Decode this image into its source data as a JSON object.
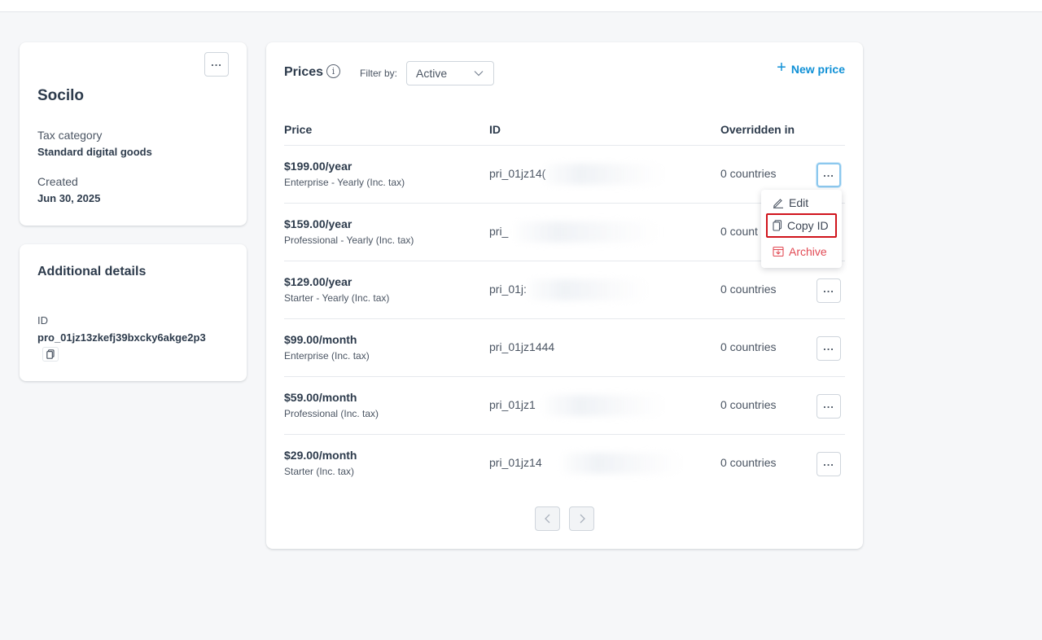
{
  "product": {
    "name": "Socilo",
    "tax_category_label": "Tax category",
    "tax_category_value": "Standard digital goods",
    "created_label": "Created",
    "created_value": "Jun 30, 2025",
    "more_label": "···"
  },
  "details": {
    "title": "Additional details",
    "id_label": "ID",
    "id_value": "pro_01jz13zkefj39bxcky6akge2p3"
  },
  "prices": {
    "title": "Prices",
    "filter_label": "Filter by:",
    "filter_value": "Active",
    "new_price_label": "New price",
    "columns": [
      "Price",
      "ID",
      "Overridden in"
    ],
    "rows": [
      {
        "price": "$199.00/year",
        "description": "Enterprise - Yearly (Inc. tax)",
        "id": "pri_01jz14(",
        "overridden": "0 countries"
      },
      {
        "price": "$159.00/year",
        "description": "Professional - Yearly (Inc. tax)",
        "id": "pri_",
        "overridden": "0 count"
      },
      {
        "price": "$129.00/year",
        "description": "Starter - Yearly (Inc. tax)",
        "id": "pri_01j:",
        "overridden": "0 countries"
      },
      {
        "price": "$99.00/month",
        "description": "Enterprise (Inc. tax)",
        "id": "pri_01jz1444",
        "overridden": "0 countries"
      },
      {
        "price": "$59.00/month",
        "description": "Professional (Inc. tax)",
        "id": "pri_01jz1",
        "overridden": "0 countries"
      },
      {
        "price": "$29.00/month",
        "description": "Starter (Inc. tax)",
        "id": "pri_01jz14",
        "overridden": "0 countries"
      }
    ]
  },
  "menu": {
    "edit": "Edit",
    "copy_id": "Copy ID",
    "archive": "Archive"
  },
  "colors": {
    "accent": "#0f90d6",
    "danger": "#e24b55",
    "highlight_box": "#d0141c"
  }
}
